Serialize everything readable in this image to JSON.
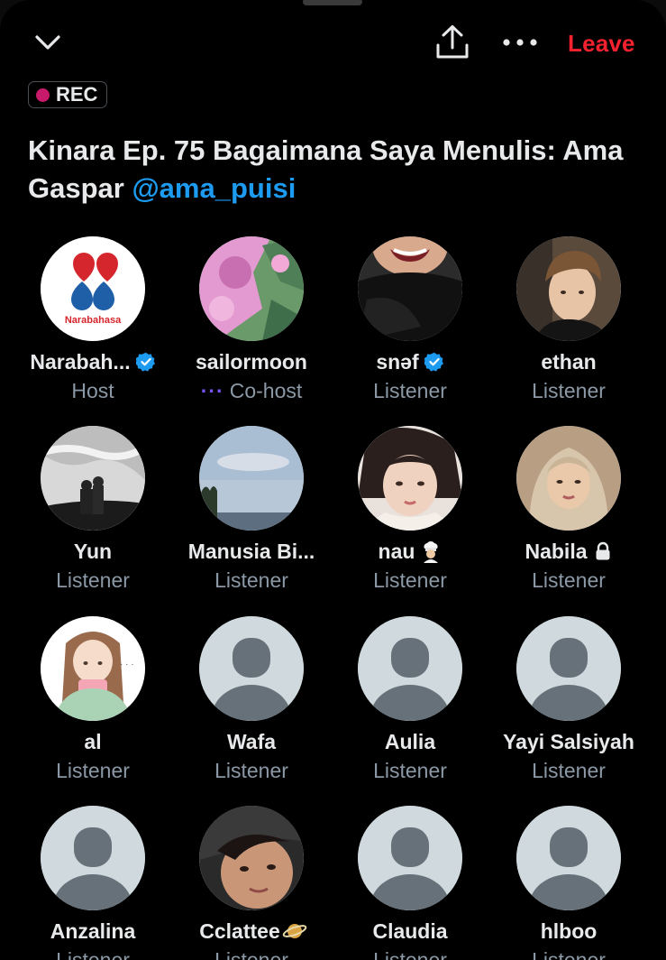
{
  "header": {
    "leave_label": "Leave",
    "rec_label": "REC",
    "icons": [
      "chevron-down-icon",
      "share-icon",
      "more-icon"
    ]
  },
  "space": {
    "title": "Kinara Ep. 75 Bagaimana Saya Menulis: Ama Gaspar",
    "title_main": "Kinara Ep. 75 Bagaimana Saya Menulis: Ama Gaspar ",
    "mention": "@ama_puisi"
  },
  "colors": {
    "accent_red": "#f4212e",
    "mention_blue": "#1d9bf0",
    "verified_blue": "#1d9bf0",
    "cohost_purple": "#7856ff",
    "role_gray": "#8b98a5"
  },
  "participants": [
    {
      "name": "Narabah...",
      "role": "Host",
      "verified": true,
      "avatar": "narabahasa-logo",
      "logo_text": "Narabahasa"
    },
    {
      "name": "sailormoon",
      "role": "Co-host",
      "role_prefix": "···",
      "avatar": "pink-green-art"
    },
    {
      "name": "snəf",
      "role": "Listener",
      "verified": true,
      "avatar": "photo-smile"
    },
    {
      "name": "ethan",
      "role": "Listener",
      "avatar": "photo-boy"
    },
    {
      "name": "Yun",
      "role": "Listener",
      "avatar": "photo-bw-couple"
    },
    {
      "name": "Manusia Bi...",
      "role": "Listener",
      "avatar": "photo-sky"
    },
    {
      "name": "nau",
      "role": "Listener",
      "emoji": "chef-emoji",
      "avatar": "photo-girl"
    },
    {
      "name": "Nabila",
      "role": "Listener",
      "lock": true,
      "avatar": "photo-hijab"
    },
    {
      "name": "al",
      "role": "Listener",
      "avatar": "illustration-girl"
    },
    {
      "name": "Wafa",
      "role": "Listener",
      "avatar": "default"
    },
    {
      "name": "Aulia",
      "role": "Listener",
      "avatar": "default"
    },
    {
      "name": "Yayi Salsiyah",
      "role": "Listener",
      "avatar": "default"
    },
    {
      "name": "Anzalina",
      "role": "Listener",
      "avatar": "default"
    },
    {
      "name": "Cclattee",
      "role": "Listener",
      "emoji": "planet-emoji",
      "avatar": "photo-face-closeup"
    },
    {
      "name": "Claudia",
      "role": "Listener",
      "avatar": "default"
    },
    {
      "name": "hlboo",
      "role": "Listener",
      "avatar": "default"
    }
  ]
}
